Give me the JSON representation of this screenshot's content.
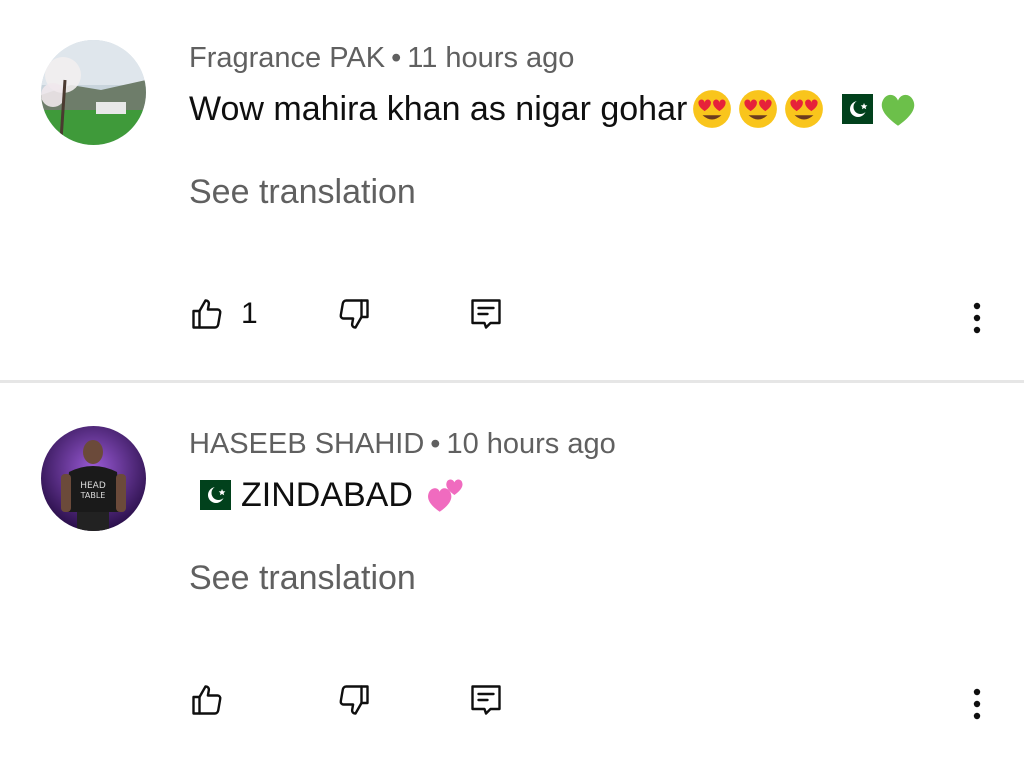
{
  "comments": [
    {
      "author": "Fragrance PAK",
      "separator": "•",
      "time": "11 hours ago",
      "text": "Wow mahira khan as nigar gohar",
      "see_translation": "See translation",
      "like_count": "1",
      "emojis": [
        "heart-eyes-emoji",
        "heart-eyes-emoji",
        "heart-eyes-emoji",
        "pakistan-flag-emoji",
        "green-heart-emoji"
      ]
    },
    {
      "author": "HASEEB SHAHID",
      "separator": "•",
      "time": "10 hours ago",
      "text": "ZINDABAD",
      "see_translation": "See translation",
      "like_count": "",
      "emojis": [
        "pakistan-flag-emoji",
        "two-hearts-emoji"
      ]
    }
  ],
  "icons": {
    "like": "thumbs-up-icon",
    "dislike": "thumbs-down-icon",
    "reply": "comment-reply-icon",
    "more": "more-vert-icon"
  },
  "colors": {
    "meta_text": "#606060",
    "primary_text": "#0f0f0f",
    "divider": "#e6e6e6",
    "flag_green": "#01411c"
  }
}
